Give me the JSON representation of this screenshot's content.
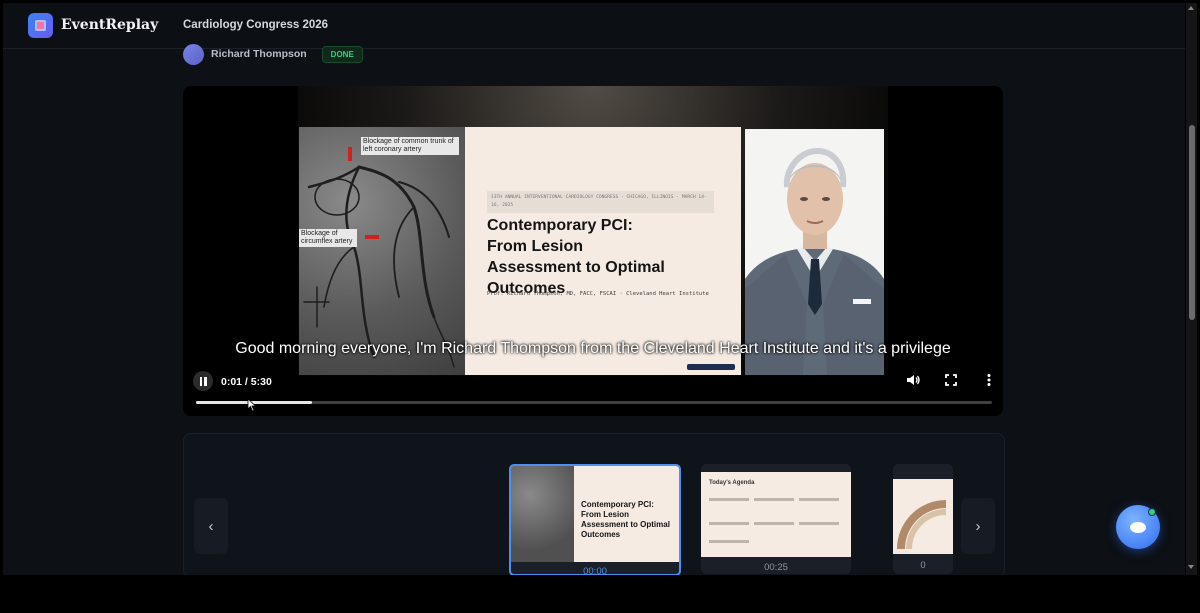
{
  "header": {
    "brand": "EventReplay",
    "event_title": "Cardiology Congress 2026"
  },
  "speaker": {
    "name": "Richard Thompson",
    "status": "DONE"
  },
  "slide": {
    "tag": "13TH ANNUAL INTERVENTIONAL CARDIOLOGY CONGRESS · CHICAGO, ILLINOIS · MARCH 14-16, 2025",
    "title_lines": [
      "Contemporary PCI:",
      "From Lesion",
      "Assessment to Optimal",
      "Outcomes"
    ],
    "subtitle": "Prof. Richard Thompson, MD, FACC, FSCAI · Cleveland Heart Institute",
    "annotation_top": "Blockage of common trunk of left coronary artery",
    "annotation_bottom": "Blockage of circumflex artery"
  },
  "player": {
    "caption": "Good morning everyone, I'm Richard Thompson from the Cleveland Heart Institute and it's a privilege",
    "time": "0:01 / 5:30",
    "progress_fraction": 0.146,
    "icons": {
      "play_pause": "pause-icon",
      "volume": "volume-icon",
      "fullscreen": "fullscreen-icon",
      "more": "more-vertical-icon"
    }
  },
  "timeline": {
    "prev_label": "‹",
    "next_label": "›",
    "thumbnails": [
      {
        "time": "00:00",
        "title_lines": [
          "Contemporary PCI:",
          "From Lesion",
          "Assessment to Optimal",
          "Outcomes"
        ],
        "active": true
      },
      {
        "time": "00:25",
        "title": "Today's Agenda",
        "active": false
      },
      {
        "time": "0",
        "active": false
      }
    ]
  },
  "colors": {
    "accent": "#3b82f6",
    "status_done": "#2fd27a",
    "background": "#0d1015"
  }
}
